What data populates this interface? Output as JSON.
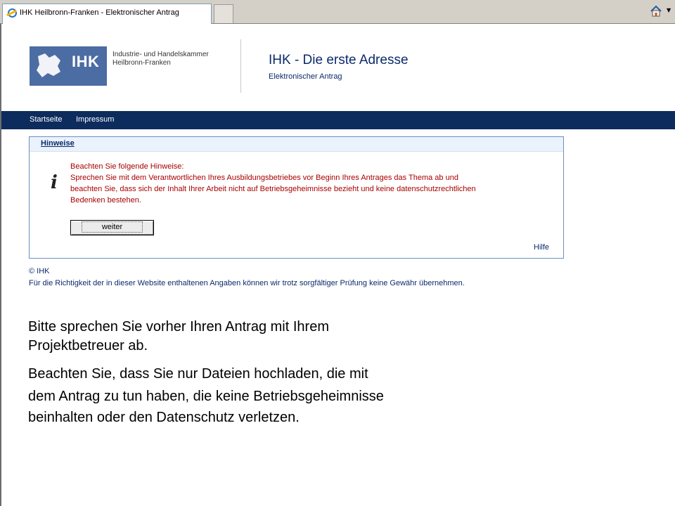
{
  "browser": {
    "tab_title": "IHK Heilbronn-Franken - Elektronischer Antrag",
    "home_icon": "home-icon"
  },
  "header": {
    "logo_text": "IHK",
    "org_line1": "Industrie- und Handelskammer",
    "org_line2": "Heilbronn-Franken",
    "title": "IHK - Die erste Adresse",
    "subtitle": "Elektronischer Antrag"
  },
  "nav": {
    "items": [
      "Startseite",
      "Impressum"
    ]
  },
  "notice": {
    "heading": "Hinweise",
    "icon": "info-icon",
    "lines": [
      "Beachten Sie folgende Hinweise:",
      "Sprechen Sie mit dem Verantwortlichen Ihres Ausbildungsbetriebes vor Beginn Ihres Antrages das Thema ab und",
      "beachten Sie, dass sich der Inhalt Ihrer Arbeit nicht auf Betriebsgeheimnisse bezieht und keine datenschutzrechtlichen",
      "Bedenken bestehen."
    ],
    "button_label": "weiter",
    "help_link": "Hilfe"
  },
  "footer": {
    "copyright": "© IHK",
    "disclaimer": "Für die Richtigkeit der in dieser Website enthaltenen Angaben können wir trotz sorgfältiger Prüfung keine Gewähr übernehmen."
  },
  "overlay": {
    "paragraph1": [
      "Bitte sprechen Sie vorher Ihren Antrag mit Ihrem",
      "Projektbetreuer ab."
    ],
    "paragraph2": [
      "Beachten Sie, dass Sie nur Dateien hochladen, die mit",
      "dem Antrag zu tun haben, die keine Betriebsgeheimnisse",
      "beinhalten oder den Datenschutz verletzen."
    ]
  },
  "colors": {
    "navbar": "#0c2c5e",
    "logo_bg": "#4c6da3",
    "notice_text": "#a80000",
    "link_text": "#0b2a6a"
  }
}
